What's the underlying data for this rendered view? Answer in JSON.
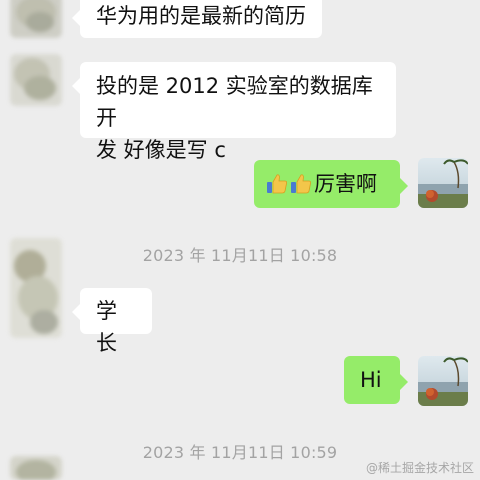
{
  "messages": [
    {
      "id": "m1",
      "text": "华为用的是最新的简历",
      "direction": "in"
    },
    {
      "id": "m2",
      "lines": [
        "投的是 2012 实验室的数据库开",
        "发 好像是写 c"
      ],
      "direction": "in"
    },
    {
      "id": "m3",
      "text": "厉害啊",
      "direction": "out",
      "emoji": [
        "thumbs-up",
        "thumbs-up"
      ]
    },
    {
      "id": "m4",
      "text": "学长",
      "direction": "in"
    },
    {
      "id": "m5",
      "text": "Hi",
      "direction": "out"
    }
  ],
  "timestamps": [
    "2023 年 11月11日 10:58",
    "2023 年 11月11日 10:59"
  ],
  "watermark": "@稀土掘金技术社区",
  "colors": {
    "background": "#ededed",
    "incoming_bubble": "#ffffff",
    "outgoing_bubble": "#95ec69",
    "timestamp_text": "#a3a3a3"
  }
}
